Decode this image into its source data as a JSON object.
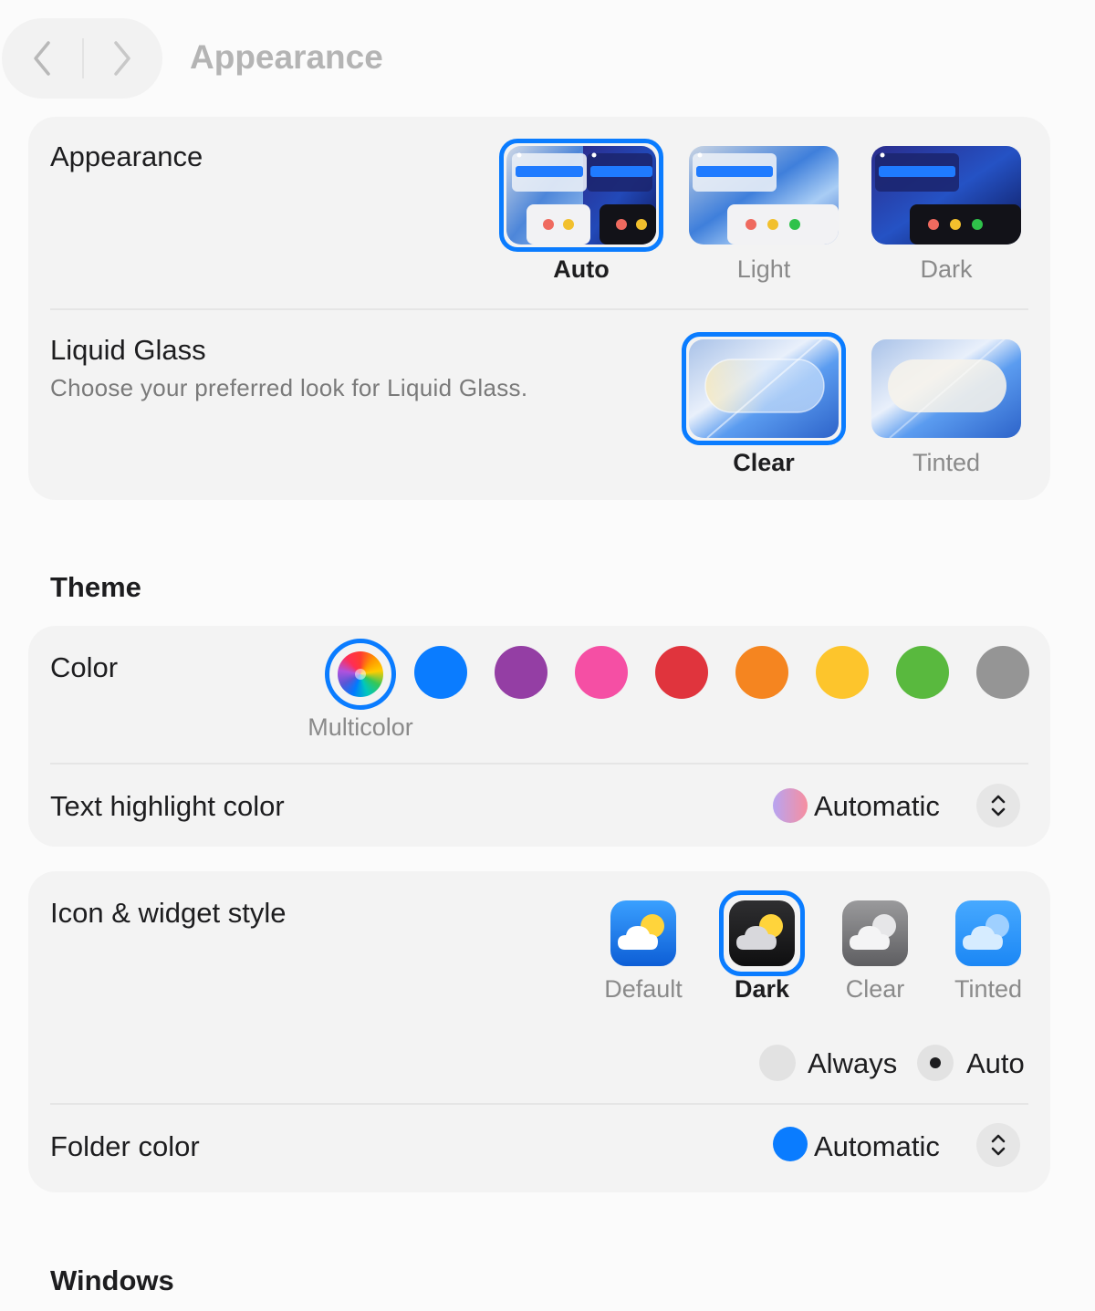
{
  "toolbar": {
    "title": "Appearance",
    "back_icon": "chevron-left-icon",
    "forward_icon": "chevron-right-icon"
  },
  "appearance": {
    "label": "Appearance",
    "selected": "Auto",
    "options": [
      {
        "label": "Auto"
      },
      {
        "label": "Light"
      },
      {
        "label": "Dark"
      }
    ]
  },
  "liquid_glass": {
    "label": "Liquid Glass",
    "description": "Choose your preferred look for Liquid Glass.",
    "selected": "Clear",
    "options": [
      {
        "label": "Clear"
      },
      {
        "label": "Tinted"
      }
    ]
  },
  "theme": {
    "title": "Theme",
    "color_label": "Color",
    "selected_color_label": "Multicolor",
    "accent_colors": [
      "#0a7cff",
      "#943ea4",
      "#f54fa4",
      "#e0343d",
      "#f58520",
      "#fdc52c",
      "#59b93e",
      "#959595"
    ],
    "selection_color": "#0a7cff",
    "text_highlight": {
      "label": "Text highlight color",
      "value": "Automatic",
      "icon": "chevron-up-down-icon"
    }
  },
  "icon_widget": {
    "label": "Icon & widget style",
    "selected": "Dark",
    "options": [
      {
        "label": "Default"
      },
      {
        "label": "Dark"
      },
      {
        "label": "Clear"
      },
      {
        "label": "Tinted"
      }
    ],
    "mode_options": [
      {
        "label": "Always",
        "selected": false
      },
      {
        "label": "Auto",
        "selected": true
      }
    ],
    "folder_color": {
      "label": "Folder color",
      "value": "Automatic",
      "swatch_color": "#0a7cff",
      "icon": "chevron-up-down-icon"
    }
  },
  "windows": {
    "title": "Windows"
  }
}
